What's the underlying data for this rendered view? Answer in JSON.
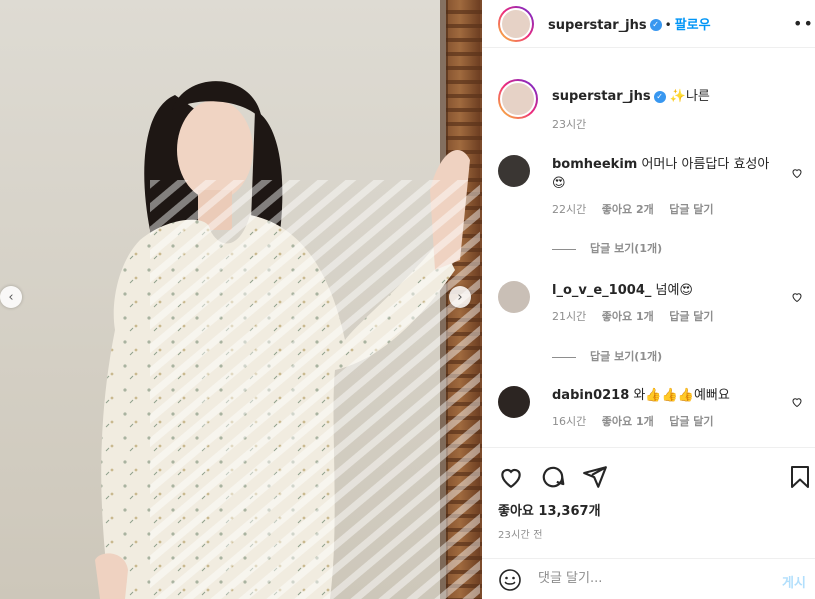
{
  "post": {
    "author": "superstar_jhs",
    "follow_label": "팔로우",
    "more_label": "•••",
    "caption_text": "✨나른",
    "caption_time": "23시간",
    "likes_label": "좋아요 13,367개",
    "time_ago": "23시간 전"
  },
  "comments": [
    {
      "username": "bomheekim",
      "text": "어머나 아름답다 효성아😍",
      "time": "22시간",
      "likes": "좋아요 2개",
      "reply_label": "답글 달기",
      "view_replies": "답글 보기(1개)"
    },
    {
      "username": "l_o_v_e_1004_",
      "text": "넘예😍",
      "time": "21시간",
      "likes": "좋아요 1개",
      "reply_label": "답글 달기",
      "view_replies": "답글 보기(1개)"
    },
    {
      "username": "dabin0218",
      "text": "와👍👍👍예뻐요",
      "time": "16시간",
      "likes": "좋아요 1개",
      "reply_label": "답글 달기"
    }
  ],
  "composer": {
    "placeholder": "댓글 달기...",
    "post_label": "게시"
  },
  "colors": {
    "accent": "#0095f6",
    "verified": "#3897f0",
    "muted": "#8e8e8e",
    "post_disabled": "#b2dffc"
  },
  "icons": [
    "chevron-left-icon",
    "chevron-right-icon",
    "verified-badge-icon",
    "more-options-icon",
    "heart-icon",
    "comment-icon",
    "share-icon",
    "bookmark-icon",
    "emoji-icon"
  ]
}
